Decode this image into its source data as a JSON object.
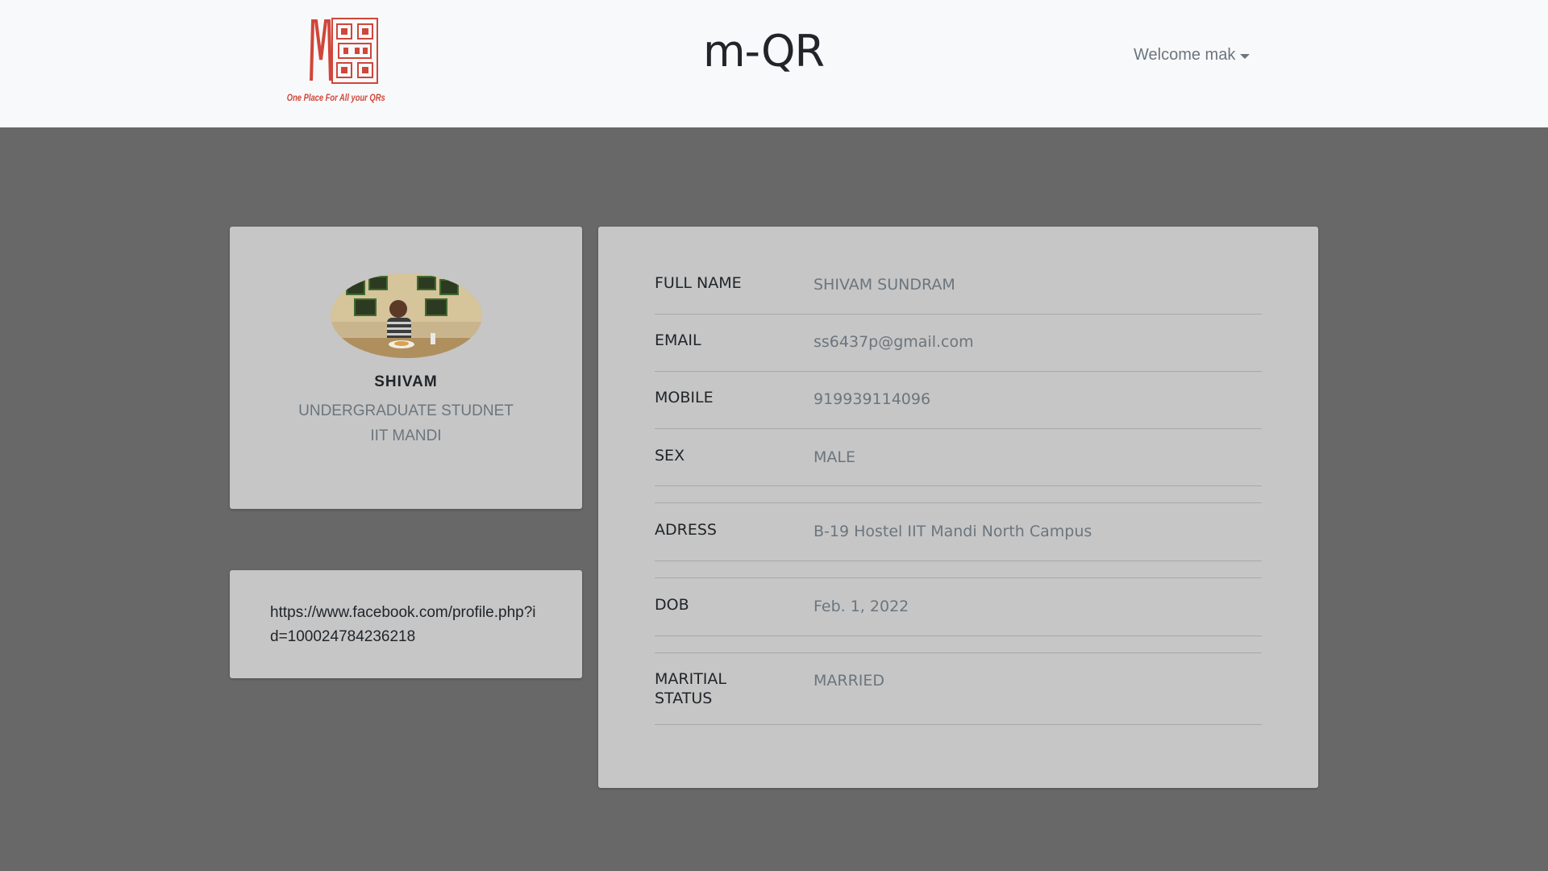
{
  "navbar": {
    "logo_tagline": "One Place For All your QRs",
    "title": "m-QR",
    "welcome_label": "Welcome mak"
  },
  "profile": {
    "name": "SHIVAM",
    "role": "UNDERGRADUATE STUDNET",
    "org": "IIT MANDI"
  },
  "link": {
    "url": "https://www.facebook.com/profile.php?id=100024784236218"
  },
  "details": {
    "full_name_label": "FULL NAME",
    "full_name_value": "SHIVAM SUNDRAM",
    "email_label": "EMAIL",
    "email_value": "ss6437p@gmail.com",
    "mobile_label": "MOBILE",
    "mobile_value": "919939114096",
    "sex_label": "SEX",
    "sex_value": "MALE",
    "address_label": "ADRESS",
    "address_value": "B-19 Hostel IIT Mandi North Campus",
    "dob_label": "DOB",
    "dob_value": "Feb. 1, 2022",
    "marital_label_line1": "MARITIAL",
    "marital_label_line2": "STATUS",
    "marital_value": "MARRIED"
  },
  "colors": {
    "page_background": "#686868",
    "navbar_background": "#f8f9fa",
    "card_background": "#c6c6c6",
    "logo_red": "#d0463a"
  }
}
